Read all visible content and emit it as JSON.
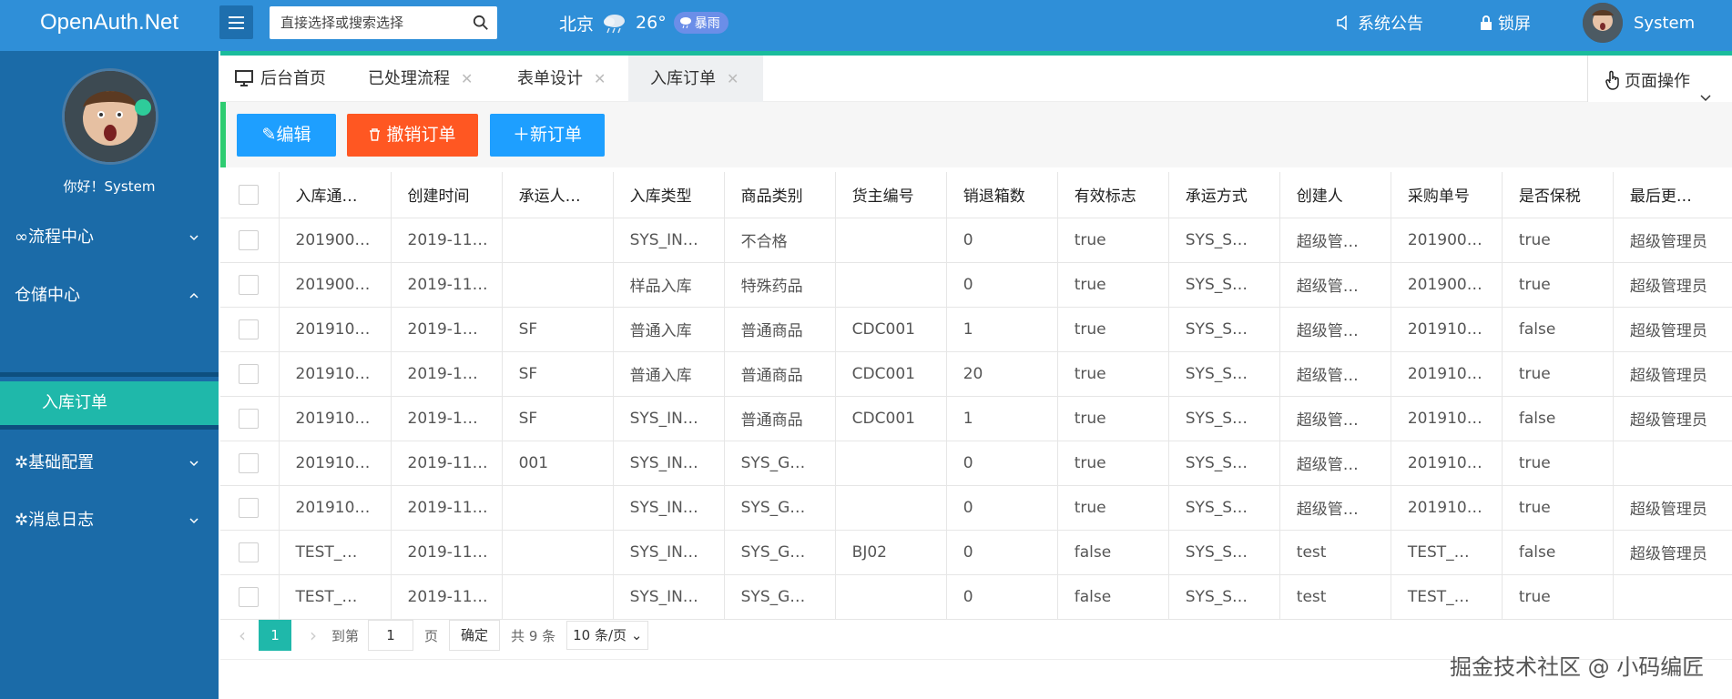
{
  "header": {
    "logo": "OpenAuth.Net",
    "search_placeholder": "直接选择或搜索选择",
    "weather": {
      "city": "北京",
      "temp": "26°",
      "badge": "暴雨",
      "icon": "cloud-rain-icon"
    },
    "announcement": "系统公告",
    "lock": "锁屏",
    "user": "System"
  },
  "sidebar": {
    "greeting": "你好！System",
    "items": [
      {
        "label": "流程中心",
        "icon": "infinity-icon",
        "expanded": false
      },
      {
        "label": "仓储中心",
        "icon": "",
        "expanded": true
      },
      {
        "label": "基础配置",
        "icon": "gear-icon",
        "expanded": false
      },
      {
        "label": "消息日志",
        "icon": "gear-icon",
        "expanded": false
      }
    ],
    "active_sub": "入库订单"
  },
  "tabs": [
    {
      "label": "后台首页",
      "closable": false
    },
    {
      "label": "已处理流程",
      "closable": true
    },
    {
      "label": "表单设计",
      "closable": true
    },
    {
      "label": "入库订单",
      "closable": true,
      "active": true
    }
  ],
  "page_ops": "页面操作",
  "toolbar": {
    "edit": "编辑",
    "cancel": "撤销订单",
    "new": "新订单",
    "colors": {
      "edit": "#1e9fff",
      "cancel": "#ff5722",
      "new": "#1e9fff"
    }
  },
  "table": {
    "headers": [
      "入库通…",
      "创建时间",
      "承运人…",
      "入库类型",
      "商品类别",
      "货主编号",
      "销退箱数",
      "有效标志",
      "承运方式",
      "创建人",
      "采购单号",
      "是否保税",
      "最后更…"
    ],
    "rows": [
      [
        "201900…",
        "2019-11…",
        "",
        "SYS_IN…",
        "不合格",
        "",
        "0",
        "true",
        "SYS_S…",
        "超级管…",
        "201900…",
        "true",
        "超级管理员"
      ],
      [
        "201900…",
        "2019-11…",
        "",
        "样品入库",
        "特殊药品",
        "",
        "0",
        "true",
        "SYS_S…",
        "超级管…",
        "201900…",
        "true",
        "超级管理员"
      ],
      [
        "201910…",
        "2019-1…",
        "SF",
        "普通入库",
        "普通商品",
        "CDC001",
        "1",
        "true",
        "SYS_S…",
        "超级管…",
        "201910…",
        "false",
        "超级管理员"
      ],
      [
        "201910…",
        "2019-1…",
        "SF",
        "普通入库",
        "普通商品",
        "CDC001",
        "20",
        "true",
        "SYS_S…",
        "超级管…",
        "201910…",
        "true",
        "超级管理员"
      ],
      [
        "201910…",
        "2019-1…",
        "SF",
        "SYS_IN…",
        "普通商品",
        "CDC001",
        "1",
        "true",
        "SYS_S…",
        "超级管…",
        "201910…",
        "false",
        "超级管理员"
      ],
      [
        "201910…",
        "2019-11…",
        "001",
        "SYS_IN…",
        "SYS_G…",
        "",
        "0",
        "true",
        "SYS_S…",
        "超级管…",
        "201910…",
        "true",
        ""
      ],
      [
        "201910…",
        "2019-11…",
        "",
        "SYS_IN…",
        "SYS_G…",
        "",
        "0",
        "true",
        "SYS_S…",
        "超级管…",
        "201910…",
        "true",
        "超级管理员"
      ],
      [
        "TEST_…",
        "2019-11…",
        "",
        "SYS_IN…",
        "SYS_G…",
        "BJ02",
        "0",
        "false",
        "SYS_S…",
        "test",
        "TEST_…",
        "false",
        "超级管理员"
      ],
      [
        "TEST_…",
        "2019-11…",
        "",
        "SYS_IN…",
        "SYS_G…",
        "",
        "0",
        "false",
        "SYS_S…",
        "test",
        "TEST_…",
        "true",
        ""
      ]
    ]
  },
  "pagination": {
    "current": "1",
    "goto_label": "到第",
    "page_value": "1",
    "page_unit": "页",
    "confirm": "确定",
    "total": "共 9 条",
    "page_size": "10 条/页"
  },
  "watermark": "掘金技术社区 @ 小码编匠"
}
